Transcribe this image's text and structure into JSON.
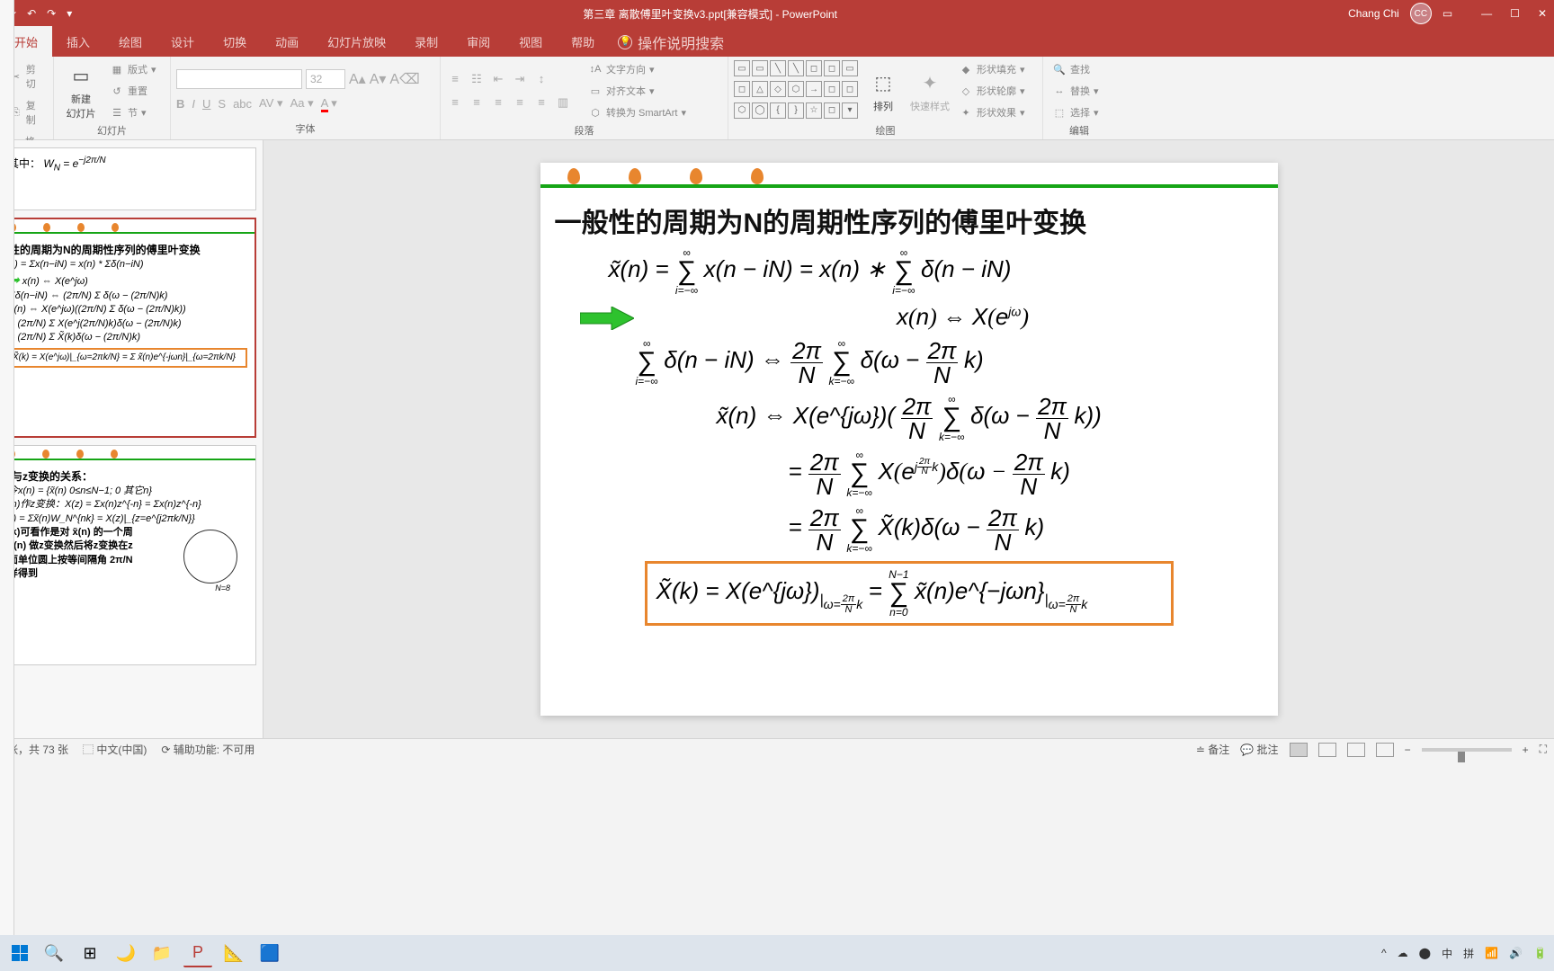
{
  "titleBar": {
    "docTitle": "第三章 离散傅里叶变换v3.ppt[兼容模式] - PowerPoint",
    "userName": "Chang Chi",
    "userInitials": "CC"
  },
  "tabs": {
    "items": [
      "开始",
      "插入",
      "绘图",
      "设计",
      "切换",
      "动画",
      "幻灯片放映",
      "录制",
      "审阅",
      "视图",
      "帮助"
    ],
    "activeIndex": 0,
    "searchHint": "操作说明搜索"
  },
  "ribbon": {
    "clipboard": {
      "label": "",
      "cut": "剪切",
      "copy": "复制",
      "formatPainter": "格式刷"
    },
    "slides": {
      "label": "幻灯片",
      "newSlide": "新建\n幻灯片",
      "layout": "版式",
      "reset": "重置",
      "section": "节"
    },
    "font": {
      "label": "字体",
      "name": "",
      "size": "32"
    },
    "paragraph": {
      "label": "段落",
      "textDirection": "文字方向",
      "alignText": "对齐文本",
      "convertSmartArt": "转换为 SmartArt"
    },
    "drawing": {
      "label": "绘图",
      "arrange": "排列",
      "quickStyles": "快速样式",
      "shapeFill": "形状填充",
      "shapeOutline": "形状轮廓",
      "shapeEffects": "形状效果"
    },
    "editing": {
      "label": "编辑",
      "find": "查找",
      "replace": "替换",
      "select": "选择"
    }
  },
  "thumbnails": {
    "thumb0": {
      "label": "其中：",
      "formula": "W_N = e^{-j2π/N}"
    },
    "thumb1": {
      "title": "性的周期为N的周期性序列的傅里叶变换",
      "eq1": "n) = Σx(n−iN) = x(n) * Σδ(n−iN)",
      "eq2": "x(n) ⇔ X(e^jω)",
      "eq3": "Σδ(n−iN) ⇔ (2π/N) Σ δ(ω − (2π/N)k)",
      "eq4": "x̃(n) ⇔ X(e^jω)((2π/N) Σ δ(ω − (2π/N)k))",
      "eq5": "= (2π/N) Σ X(e^j(2π/N)k)δ(ω − (2π/N)k)",
      "eq6": "= (2π/N) Σ X̃(k)δ(ω − (2π/N)k)",
      "eq7": "X̃(k) = X(e^jω)|_{ω=2πk/N} = Σ x̃(n)e^{-jωn}|_{ω=2πk/N}"
    },
    "thumb2": {
      "title": ")与z变换的关系：",
      "eq1": "令x(n) = {x̃(n)  0≤n≤N−1; 0  其它n}",
      "eq2": "(n)作z变换：X(z) = Σx(n)z^{-n} = Σx(n)z^{-n}",
      "eq3": "k) = Σx̃(n)W_N^{nk} = X(z)|_{z=e^{j2πk/N}}",
      "text1": "(k)可看作是对 x̃(n) 的一个周",
      "text2": "x(n) 做z变换然后将z变换在z",
      "text3": "面单位圆上按等间隔角 2π/N",
      "text4": "样得到",
      "circleLabel": "N=8"
    }
  },
  "slide": {
    "title": "一般性的周期为N的周期性序列的傅里叶变换",
    "eq1_lhs": "x̃(n) = ",
    "eq1_sum1_top": "∞",
    "eq1_sum1_bot": "i=−∞",
    "eq1_mid": "x(n − iN) = x(n) ∗ ",
    "eq1_sum2_top": "∞",
    "eq1_sum2_bot": "i=−∞",
    "eq1_rhs": "δ(n − iN)",
    "eq2": "x(n) ⇔ X(e^{jω})",
    "eq3_sum1_top": "∞",
    "eq3_sum1_bot": "i=−∞",
    "eq3_lhs": "δ(n − iN) ⇔ ",
    "eq3_frac_num": "2π",
    "eq3_frac_den": "N",
    "eq3_sum2_top": "∞",
    "eq3_sum2_bot": "k=−∞",
    "eq3_rhs": " δ(ω − ",
    "eq3_frac2_num": "2π",
    "eq3_frac2_den": "N",
    "eq3_end": "k)",
    "eq4_lhs": "x̃(n) ⇔ X(e^{jω})(",
    "eq4_rhs": " δ(ω − ",
    "eq4_end": "k))",
    "eq5_lhs": "= ",
    "eq5_mid": " X(e^{j(2π/N)k})δ(ω − ",
    "eq5_end": "k)",
    "eq6_mid": " X̃(k)δ(ω − ",
    "eq6_end": "k)",
    "eq7_lhs": "X̃(k) = X(e^{jω})",
    "eq7_sub1": "|_{ω=(2π/N)k}",
    "eq7_mid": " = ",
    "eq7_sum_top": "N−1",
    "eq7_sum_bot": "n=0",
    "eq7_rhs": " x̃(n)e^{−jωn}",
    "eq7_sub2": "|_{ω=(2π/N)k}"
  },
  "statusBar": {
    "slideInfo": "张，共 73 张",
    "language": "中文(中国)",
    "accessibility": "辅助功能: 不可用",
    "notes": "备注",
    "comments": "批注"
  },
  "taskbar": {
    "imeLang": "中",
    "imeMode": "拼"
  }
}
